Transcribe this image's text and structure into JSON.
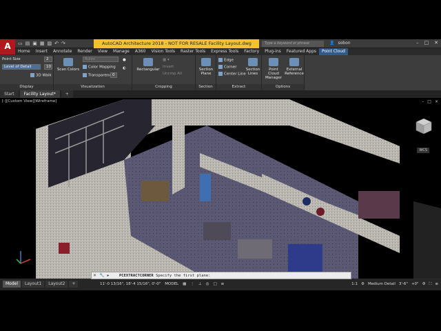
{
  "title_bar": {
    "app_letter": "A",
    "title": "AutoCAD Architecture 2018 - NOT FOR RESALE    Facility Layout.dwg",
    "search_placeholder": "Type a keyword or phrase",
    "user_name": "sobon",
    "qat_icons": [
      "new-icon",
      "open-icon",
      "save-icon",
      "saveas-icon",
      "plot-icon",
      "undo-icon",
      "redo-icon"
    ]
  },
  "ribbon_tabs": [
    "Home",
    "Insert",
    "Annotate",
    "Render",
    "View",
    "Manage",
    "A360",
    "Vision Tools",
    "Raster Tools",
    "Express Tools",
    "Factory",
    "Plug-ins",
    "Featured Apps",
    "Point Cloud"
  ],
  "active_tab": "Point Cloud",
  "panels": {
    "display": {
      "title": "Display",
      "point_size_label": "Point Size",
      "point_size_value": "2",
      "level_of_detail_label": "Level of Detail",
      "level_of_detail_value": "10",
      "walk_label": "3D Walk"
    },
    "visualization": {
      "title": "Visualization",
      "scan_colors_label": "Scan Colors",
      "color_mapping_label": "Color Mapping",
      "transparency_label": "Transparency",
      "transparency_value": "0",
      "style_value": "Rules"
    },
    "cropping": {
      "title": "Cropping",
      "rectangular_label": "Rectangular",
      "invert_label": "Invert",
      "uncrop_label": "Uncrop All"
    },
    "section": {
      "title": "Section",
      "section_plane_label": "Section Plane"
    },
    "extract": {
      "title": "Extract",
      "edge_label": "Edge",
      "corner_label": "Corner",
      "center_line_label": "Center Line",
      "section_lines_label": "Section Lines"
    },
    "options": {
      "title": "Options",
      "manager_label": "Point Cloud Manager",
      "external_ref_label": "External Reference"
    }
  },
  "file_tabs": [
    "Start",
    "Facility Layout*"
  ],
  "active_file_tab": "Facility Layout*",
  "viewport": {
    "label": "[-][Custom View][Wireframe]",
    "wcs_label": "WCS",
    "controls": [
      "–",
      "□",
      "×"
    ]
  },
  "command_line": {
    "command": "PCEXTRACTCORNER",
    "prompt": "Specify the first plane:"
  },
  "status": {
    "layout_tabs": [
      "Model",
      "Layout1",
      "Layout2"
    ],
    "active_layout": "Model",
    "coordinates": "11'-0 13/16\", 18'-4 15/16\", 0'-0\"",
    "model_label": "MODEL",
    "scale": "1:1",
    "detail": "Medium Detail",
    "dimension": "3'-6\"",
    "elevation": "+0\""
  },
  "colors": {
    "title_bar_yellow": "#f2c232",
    "active_tab": "#2f5a8a",
    "app_red": "#b3171e"
  }
}
